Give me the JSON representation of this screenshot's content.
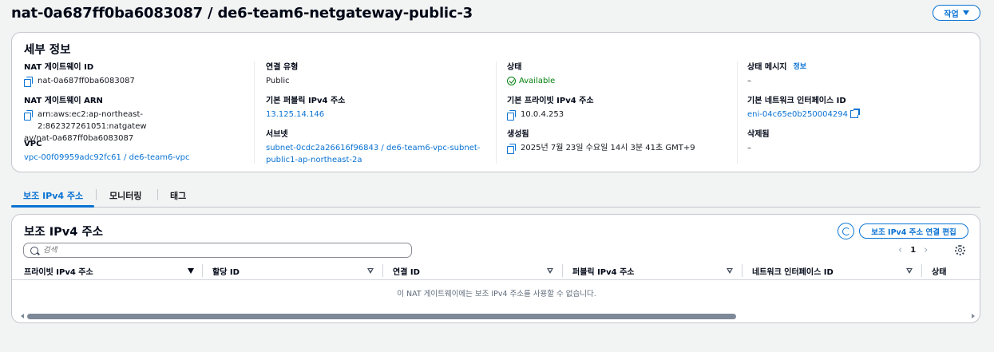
{
  "header": {
    "title": "nat-0a687ff0ba6083087 / de6-team6-netgateway-public-3",
    "actions_label": "작업"
  },
  "details": {
    "title": "세부 정보",
    "info_link": "정보",
    "col1": {
      "nat_id_label": "NAT 게이트웨이 ID",
      "nat_id_value": "nat-0a687ff0ba6083087",
      "arn_label": "NAT 게이트웨이 ARN",
      "arn_line1": "arn:aws:ec2:ap-northeast-2:862327261051:natgatew",
      "arn_line2": "ay/nat-0a687ff0ba6083087",
      "vpc_label": "VPC",
      "vpc_value": "vpc-00f09959adc92fc61 / de6-team6-vpc"
    },
    "col2": {
      "conn_type_label": "연결 유형",
      "conn_type_value": "Public",
      "public_ip_label": "기본 퍼블릭 IPv4 주소",
      "public_ip_value": "13.125.14.146",
      "subnet_label": "서브넷",
      "subnet_line1": "subnet-0cdc2a26616f96843 / de6-team6-vpc-subnet-",
      "subnet_line2": "public1-ap-northeast-2a"
    },
    "col3": {
      "state_label": "상태",
      "state_value": "Available",
      "private_ip_label": "기본 프라이빗 IPv4 주소",
      "private_ip_value": "10.0.4.253",
      "created_label": "생성됨",
      "created_value": "2025년 7월 23일 수요일 14시 3분 41초 GMT+9"
    },
    "col4": {
      "state_msg_label": "상태 메시지",
      "state_msg_value": "–",
      "eni_label": "기본 네트워크 인터페이스 ID",
      "eni_value": "eni-04c65e0b250004294",
      "deleted_label": "삭제됨",
      "deleted_value": "–"
    }
  },
  "tabs": [
    {
      "label": "보조 IPv4 주소",
      "active": true
    },
    {
      "label": "모니터링",
      "active": false
    },
    {
      "label": "태그",
      "active": false
    }
  ],
  "secondary": {
    "title": "보조 IPv4 주소",
    "edit_label": "보조 IPv4 주소 연결 편집",
    "search_placeholder": "검색",
    "page": "1",
    "columns": [
      "프라이빗 IPv4 주소",
      "할당 ID",
      "연결 ID",
      "퍼블릭 IPv4 주소",
      "네트워크 인터페이스 ID",
      "상태"
    ],
    "empty_message": "이 NAT 게이트웨이에는 보조 IPv4 주소를 사용할 수 없습니다."
  },
  "colors": {
    "accent": "#0972d3",
    "success": "#037f0c",
    "text": "#16191f"
  }
}
